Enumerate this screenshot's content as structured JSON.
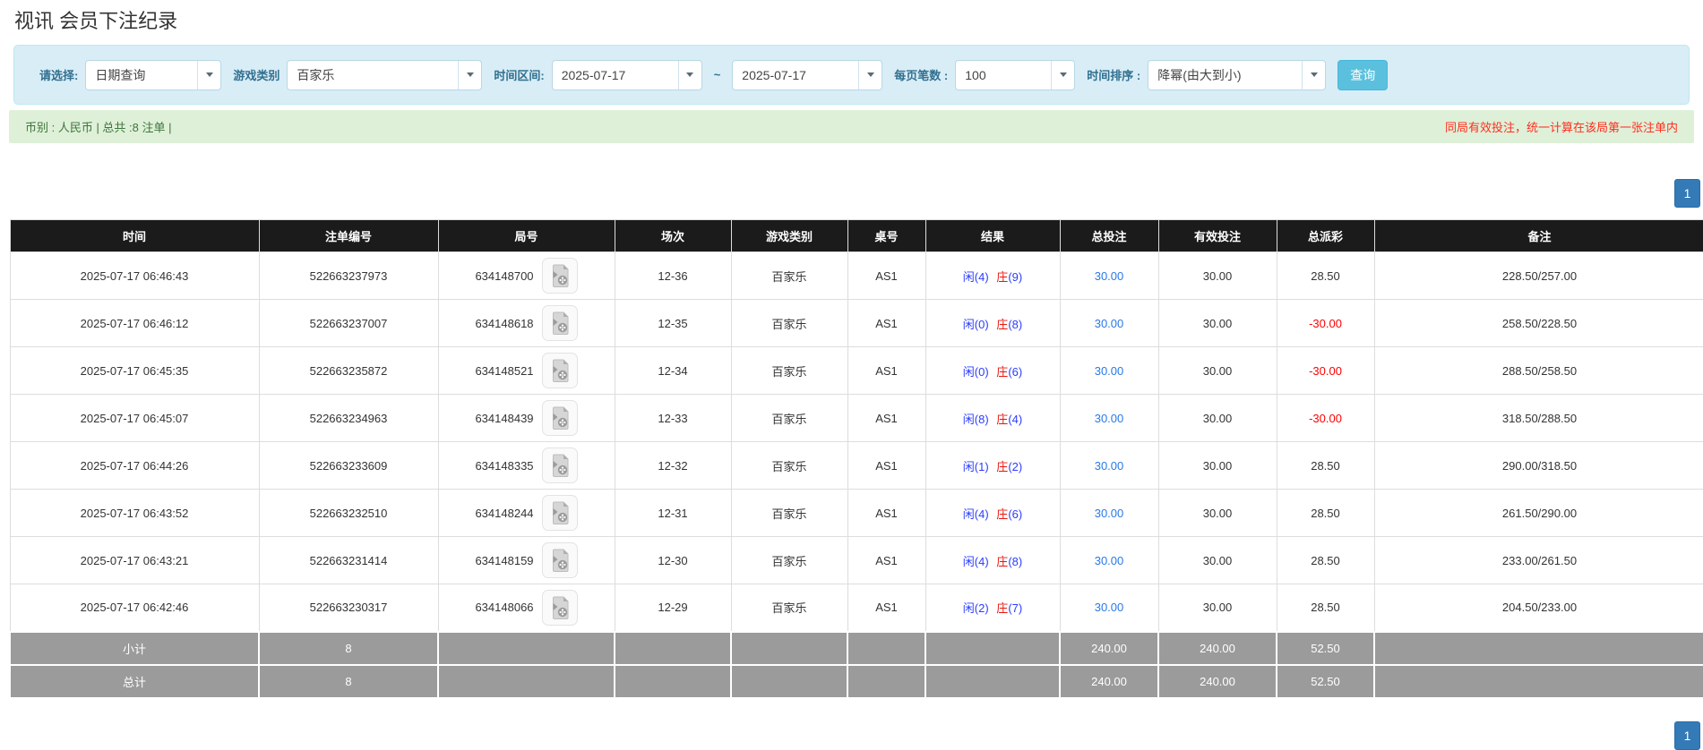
{
  "title": "视讯 会员下注纪录",
  "filters": {
    "select_label": "请选择:",
    "select_value": "日期查询",
    "game_label": "游戏类别",
    "game_value": "百家乐",
    "range_label": "时间区间:",
    "date_from": "2025-07-17",
    "range_separator": "~",
    "date_to": "2025-07-17",
    "page_size_label": "每页笔数 :",
    "page_size_value": "100",
    "sort_label": "时间排序 :",
    "sort_value": "降幂(由大到小)",
    "search_button": "查询"
  },
  "summary_bar": {
    "left_text": "币别 : 人民币 | 总共 :8 注单 |",
    "right_note": "同局有效投注，统一计算在该局第一张注单内"
  },
  "pagination": {
    "page": "1"
  },
  "icons": {
    "chevron": "chevron-down-icon",
    "video": "video-record-icon"
  },
  "colors": {
    "accent_blue": "#337ab7",
    "search_button_blue": "#5bc0de",
    "panel_bg": "#d9edf7",
    "success_bg": "#dff0d8",
    "success_text": "#3c763d",
    "note_red": "#ff2e1f",
    "header_bg": "#1b1b1b",
    "link_blue": "#2979e8",
    "player_blue": "#2b3cff",
    "banker_red": "#e8150c",
    "negative_red": "#ff0000",
    "summary_gray": "#9b9b9b"
  },
  "table": {
    "headers": [
      "时间",
      "注单编号",
      "局号",
      "场次",
      "游戏类别",
      "桌号",
      "结果",
      "总投注",
      "有效投注",
      "总派彩",
      "备注"
    ],
    "rows": [
      {
        "time": "2025-07-17 06:46:43",
        "bet_id": "522663237973",
        "round_id": "634148700",
        "session": "12-36",
        "game": "百家乐",
        "table_no": "AS1",
        "result_player": "闲(4)",
        "result_banker": "庄",
        "result_banker_score": "(9)",
        "total_bet": "30.00",
        "valid_bet": "30.00",
        "payout": "28.50",
        "payout_negative": false,
        "remark": "228.50/257.00"
      },
      {
        "time": "2025-07-17 06:46:12",
        "bet_id": "522663237007",
        "round_id": "634148618",
        "session": "12-35",
        "game": "百家乐",
        "table_no": "AS1",
        "result_player": "闲(0)",
        "result_banker": "庄",
        "result_banker_score": "(8)",
        "total_bet": "30.00",
        "valid_bet": "30.00",
        "payout": "-30.00",
        "payout_negative": true,
        "remark": "258.50/228.50"
      },
      {
        "time": "2025-07-17 06:45:35",
        "bet_id": "522663235872",
        "round_id": "634148521",
        "session": "12-34",
        "game": "百家乐",
        "table_no": "AS1",
        "result_player": "闲(0)",
        "result_banker": "庄",
        "result_banker_score": "(6)",
        "total_bet": "30.00",
        "valid_bet": "30.00",
        "payout": "-30.00",
        "payout_negative": true,
        "remark": "288.50/258.50"
      },
      {
        "time": "2025-07-17 06:45:07",
        "bet_id": "522663234963",
        "round_id": "634148439",
        "session": "12-33",
        "game": "百家乐",
        "table_no": "AS1",
        "result_player": "闲(8)",
        "result_banker": "庄",
        "result_banker_score": "(4)",
        "total_bet": "30.00",
        "valid_bet": "30.00",
        "payout": "-30.00",
        "payout_negative": true,
        "remark": "318.50/288.50"
      },
      {
        "time": "2025-07-17 06:44:26",
        "bet_id": "522663233609",
        "round_id": "634148335",
        "session": "12-32",
        "game": "百家乐",
        "table_no": "AS1",
        "result_player": "闲(1)",
        "result_banker": "庄",
        "result_banker_score": "(2)",
        "total_bet": "30.00",
        "valid_bet": "30.00",
        "payout": "28.50",
        "payout_negative": false,
        "remark": "290.00/318.50"
      },
      {
        "time": "2025-07-17 06:43:52",
        "bet_id": "522663232510",
        "round_id": "634148244",
        "session": "12-31",
        "game": "百家乐",
        "table_no": "AS1",
        "result_player": "闲(4)",
        "result_banker": "庄",
        "result_banker_score": "(6)",
        "total_bet": "30.00",
        "valid_bet": "30.00",
        "payout": "28.50",
        "payout_negative": false,
        "remark": "261.50/290.00"
      },
      {
        "time": "2025-07-17 06:43:21",
        "bet_id": "522663231414",
        "round_id": "634148159",
        "session": "12-30",
        "game": "百家乐",
        "table_no": "AS1",
        "result_player": "闲(4)",
        "result_banker": "庄",
        "result_banker_score": "(8)",
        "total_bet": "30.00",
        "valid_bet": "30.00",
        "payout": "28.50",
        "payout_negative": false,
        "remark": "233.00/261.50"
      },
      {
        "time": "2025-07-17 06:42:46",
        "bet_id": "522663230317",
        "round_id": "634148066",
        "session": "12-29",
        "game": "百家乐",
        "table_no": "AS1",
        "result_player": "闲(2)",
        "result_banker": "庄",
        "result_banker_score": "(7)",
        "total_bet": "30.00",
        "valid_bet": "30.00",
        "payout": "28.50",
        "payout_negative": false,
        "remark": "204.50/233.00"
      }
    ],
    "subtotal": {
      "label": "小计",
      "count": "8",
      "total_bet": "240.00",
      "valid_bet": "240.00",
      "payout": "52.50"
    },
    "total": {
      "label": "总计",
      "count": "8",
      "total_bet": "240.00",
      "valid_bet": "240.00",
      "payout": "52.50"
    }
  }
}
